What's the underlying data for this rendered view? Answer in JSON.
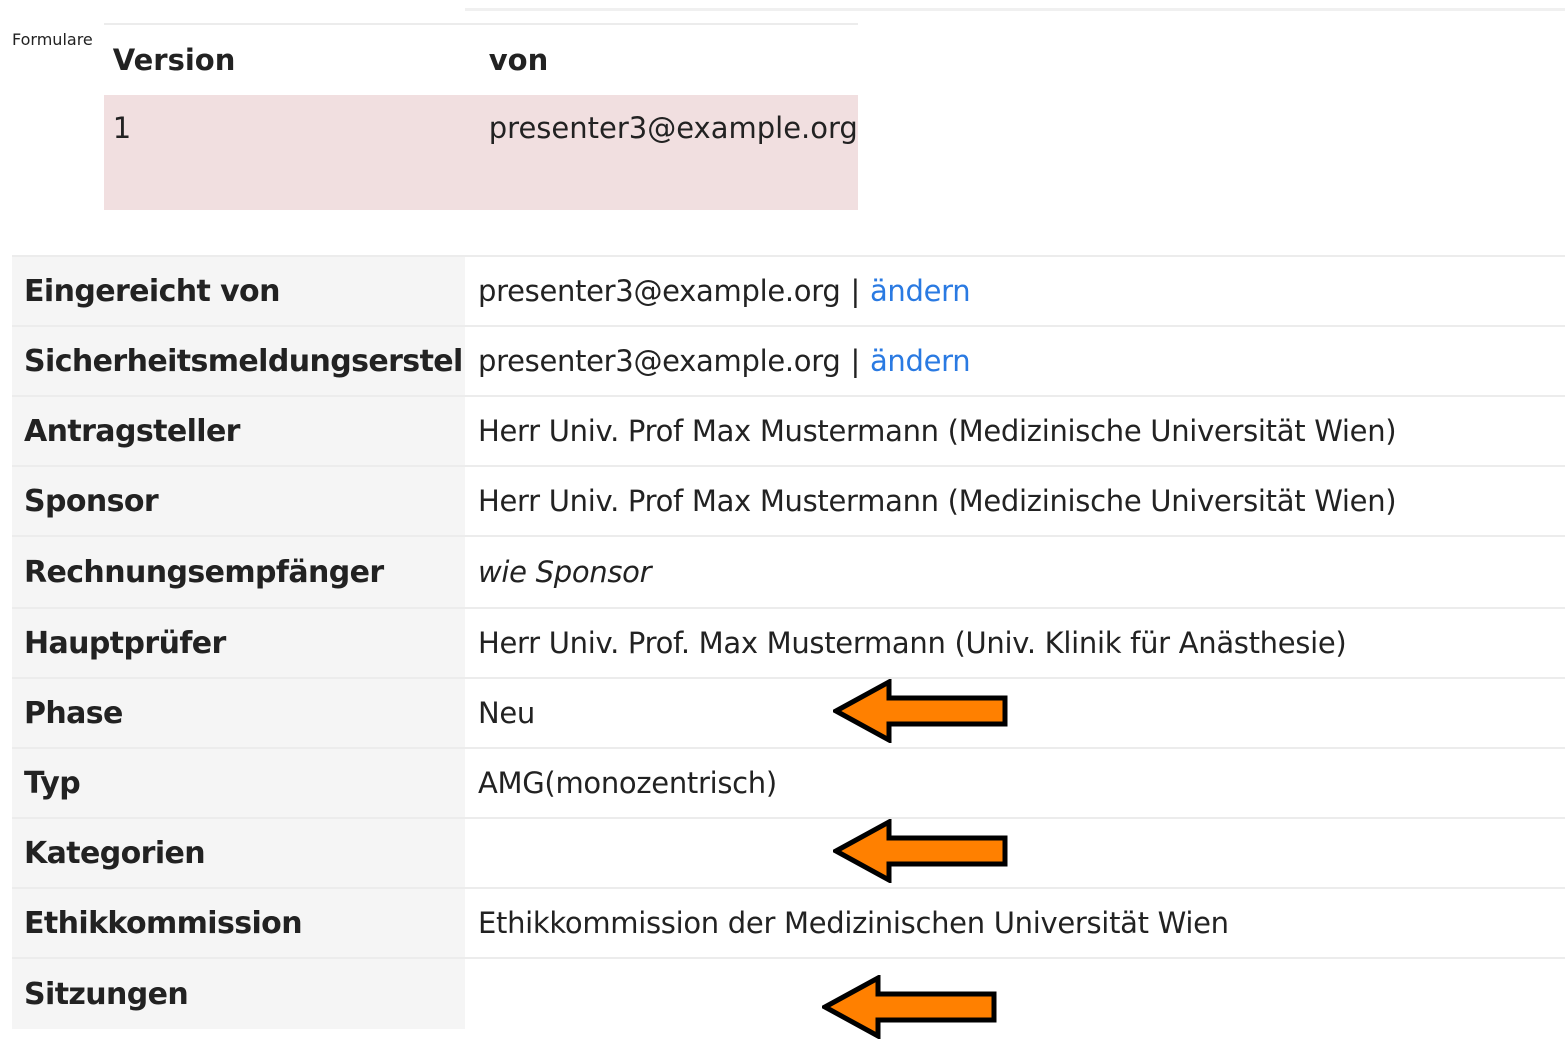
{
  "formulare": {
    "label": "Formulare",
    "headers": [
      "Version",
      "von"
    ],
    "rows": [
      {
        "version": "1",
        "von": "presenter3@example.org"
      }
    ]
  },
  "details": {
    "eingereicht": {
      "label": "Eingereicht von",
      "value": "presenter3@example.org",
      "separator": "|",
      "link": "ändern"
    },
    "ersteller": {
      "label": "Sicherheitsmeldungsersteller",
      "value": "presenter3@example.org",
      "separator": "|",
      "link": "ändern"
    },
    "antragsteller": {
      "label": "Antragsteller",
      "value": "Herr Univ. Prof Max Mustermann (Medizinische Universität Wien)"
    },
    "sponsor": {
      "label": "Sponsor",
      "value": "Herr Univ. Prof Max Mustermann (Medizinische Universität Wien)"
    },
    "rechnung": {
      "label": "Rechnungsempfänger",
      "value": "wie Sponsor"
    },
    "hauptpruefer": {
      "label": "Hauptprüfer",
      "value": "Herr Univ. Prof. Max Mustermann (Univ. Klinik für Anästhesie)"
    },
    "phase": {
      "label": "Phase",
      "value": "Neu"
    },
    "typ": {
      "label": "Typ",
      "value": "AMG(monozentrisch)"
    },
    "kategorien": {
      "label": "Kategorien",
      "value": ""
    },
    "ethik": {
      "label": "Ethikkommission",
      "value": "Ethikkommission der Medizinischen Universität Wien"
    },
    "sitzungen": {
      "label": "Sitzungen",
      "value": ""
    }
  },
  "colors": {
    "link": "#2a7ae2",
    "highlight_row": "#f1dfe0",
    "arrow_fill": "#ff8000",
    "arrow_stroke": "#000000"
  },
  "annotations": {
    "icon": "left-arrow-icon",
    "count": 3
  }
}
